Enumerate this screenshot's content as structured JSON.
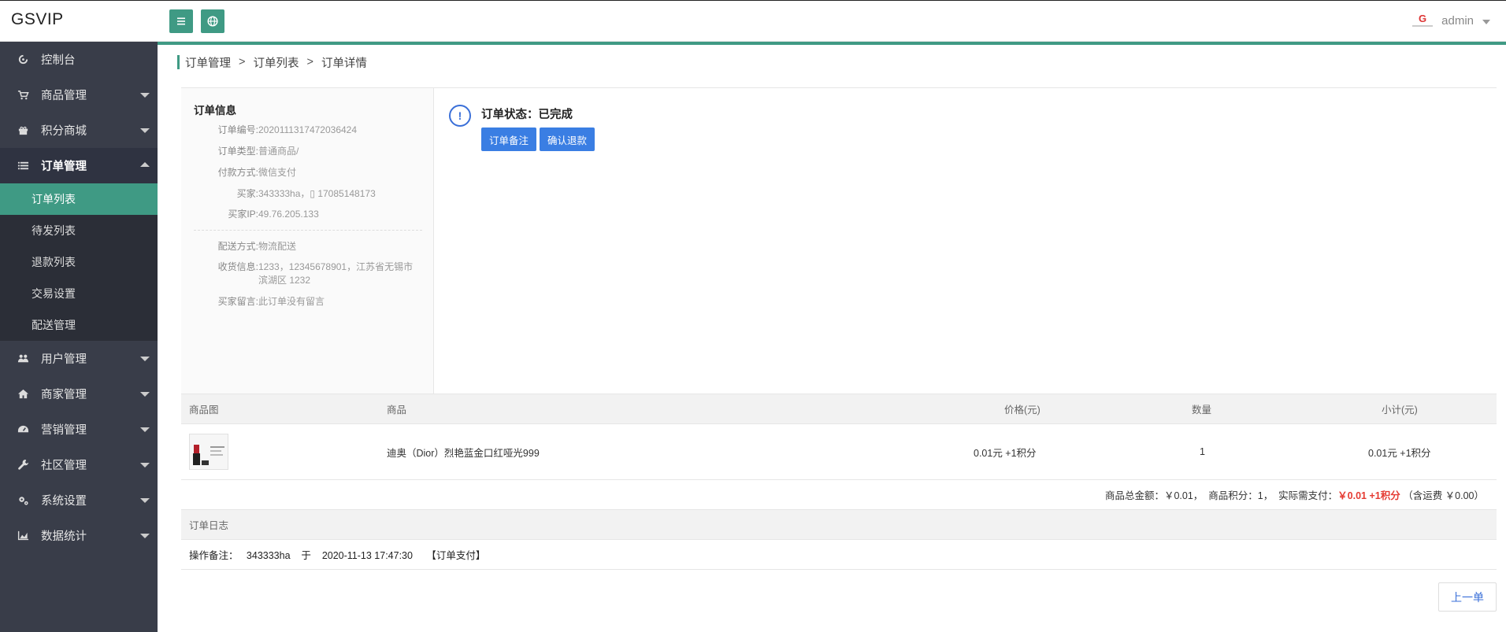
{
  "app": {
    "logo": "GSVIP",
    "user": "admin"
  },
  "sidebar": {
    "items": [
      {
        "label": "控制台",
        "icon": "dashboard-icon"
      },
      {
        "label": "商品管理",
        "icon": "cart-icon"
      },
      {
        "label": "积分商城",
        "icon": "gift-icon"
      },
      {
        "label": "订单管理",
        "icon": "list-icon",
        "open": true
      },
      {
        "label": "用户管理",
        "icon": "users-icon"
      },
      {
        "label": "商家管理",
        "icon": "home-icon"
      },
      {
        "label": "营销管理",
        "icon": "gauge-icon"
      },
      {
        "label": "社区管理",
        "icon": "wrench-icon"
      },
      {
        "label": "系统设置",
        "icon": "cogs-icon"
      },
      {
        "label": "数据统计",
        "icon": "area-chart-icon"
      }
    ],
    "sub_items": [
      "订单列表",
      "待发列表",
      "退款列表",
      "交易设置",
      "配送管理"
    ],
    "active_sub": "订单列表"
  },
  "breadcrumb": {
    "items": [
      "订单管理",
      "订单列表",
      "订单详情"
    ],
    "separator": ">"
  },
  "order_info": {
    "title": "订单信息",
    "fields": [
      {
        "key": "订单编号:",
        "value": "2020111317472036424"
      },
      {
        "key": "订单类型:",
        "value": "普通商品/"
      },
      {
        "key": "付款方式:",
        "value": "微信支付"
      },
      {
        "key": "买家:",
        "value": "343333ha，▯ 17085148173"
      },
      {
        "key": "买家IP:",
        "value": "49.76.205.133"
      }
    ],
    "shipping_fields": [
      {
        "key": "配送方式:",
        "value": "物流配送"
      },
      {
        "key": "收货信息:",
        "value": "1233，12345678901，江苏省无锡市滨湖区 1232"
      },
      {
        "key": "买家留言:",
        "value": "此订单没有留言"
      }
    ]
  },
  "status": {
    "text": "订单状态：已完成",
    "remark_button": "订单备注",
    "refund_button": "确认退款"
  },
  "products_table": {
    "headers": {
      "image": "商品图",
      "product": "商品",
      "price": "价格(元)",
      "qty": "数量",
      "subtotal": "小计(元)"
    },
    "rows": [
      {
        "name": "迪奥（Dior）烈艳蓝金口红哑光999",
        "price": "0.01元 +1积分",
        "qty": "1",
        "subtotal": "0.01元 +1积分"
      }
    ]
  },
  "summary": {
    "prefix": "商品总金额：￥0.01，  商品积分：1，  实际需支付：",
    "pay": "￥0.01 +1积分",
    "suffix": " （含运费 ￥0.00）"
  },
  "log": {
    "title": "订单日志",
    "entry": "操作备注：   343333ha    于    2020-11-13 17:47:30     【订单支付】"
  },
  "prev_button": "上一单",
  "colors": {
    "accent": "#3f9a84",
    "primary_button": "#3a7ee3",
    "sidebar_bg": "#393d49",
    "price_red": "#e53b32"
  }
}
